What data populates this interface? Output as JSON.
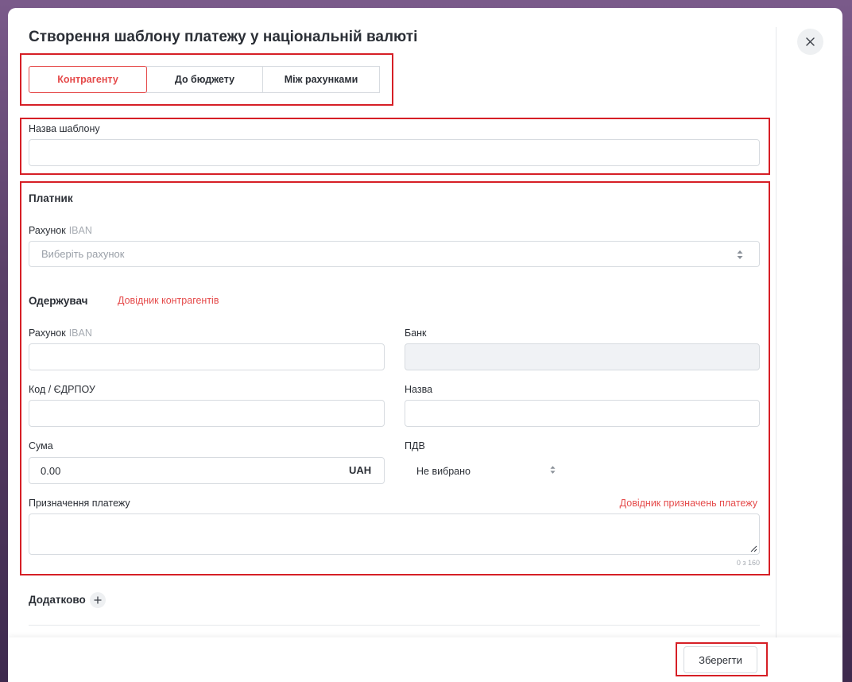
{
  "modal": {
    "title": "Створення шаблону платежу у національній валюті",
    "close_icon": "close-icon"
  },
  "tabs": [
    {
      "label": "Контрагенту",
      "active": true
    },
    {
      "label": "До бюджету",
      "active": false
    },
    {
      "label": "Між рахунками",
      "active": false
    }
  ],
  "template_name": {
    "label": "Назва шаблону",
    "value": ""
  },
  "payer": {
    "title": "Платник",
    "account_label": "Рахунок",
    "account_sub": "IBAN",
    "account_placeholder": "Виберіть рахунок"
  },
  "recipient": {
    "title": "Одержувач",
    "directory_link": "Довідник контрагентів",
    "account_label": "Рахунок",
    "account_sub": "IBAN",
    "bank_label": "Банк",
    "code_label": "Код / ЄДРПОУ",
    "name_label": "Назва",
    "amount_label": "Сума",
    "amount_value": "0.00",
    "currency": "UAH",
    "vat_label": "ПДВ",
    "vat_value": "Не вибрано",
    "purpose_label": "Призначення платежу",
    "purpose_link": "Довідник призначень платежу",
    "purpose_counter": "0 з 160"
  },
  "additional": {
    "title": "Додатково"
  },
  "footer": {
    "save_label": "Зберегти"
  },
  "colors": {
    "accent": "#e54b4b",
    "highlight": "#d61f26",
    "border": "#d7dbe0",
    "text": "#2b2f36"
  }
}
